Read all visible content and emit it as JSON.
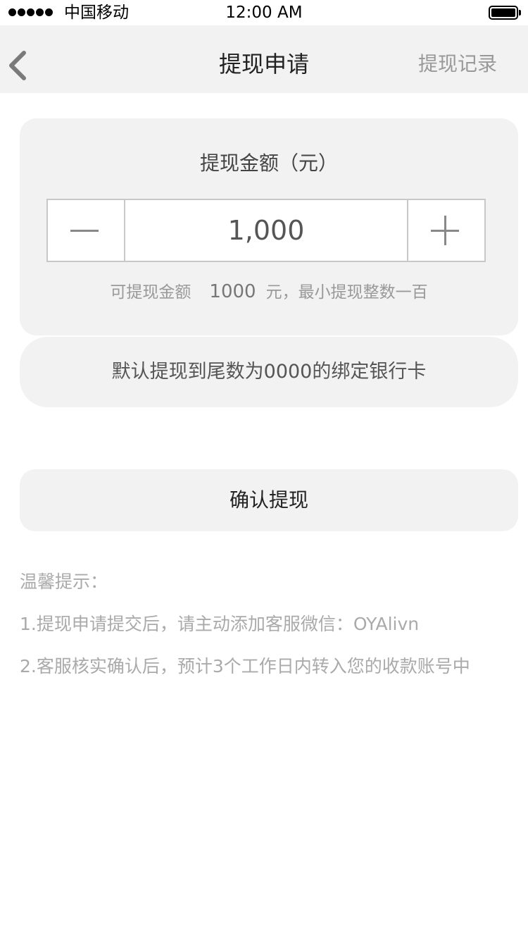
{
  "status_bar": {
    "carrier": "中国移动",
    "time": "12:00 AM"
  },
  "nav": {
    "title": "提现申请",
    "right_action": "提现记录",
    "back_icon": "chevron-left-icon"
  },
  "amount_card": {
    "label": "提现金额（元）",
    "value": "1,000",
    "available_prefix": "可提现金额",
    "available_amount": "1000",
    "available_suffix": "元，最小提现整数一百"
  },
  "bank_card": {
    "text": "默认提现到尾数为0000的绑定银行卡"
  },
  "confirm_button": {
    "label": "确认提现"
  },
  "tips": {
    "title": "温馨提示：",
    "items": [
      "1.提现申请提交后，请主动添加客服微信：OYAlivn",
      "2.客服核实确认后，预计3个工作日内转入您的收款账号中"
    ]
  }
}
